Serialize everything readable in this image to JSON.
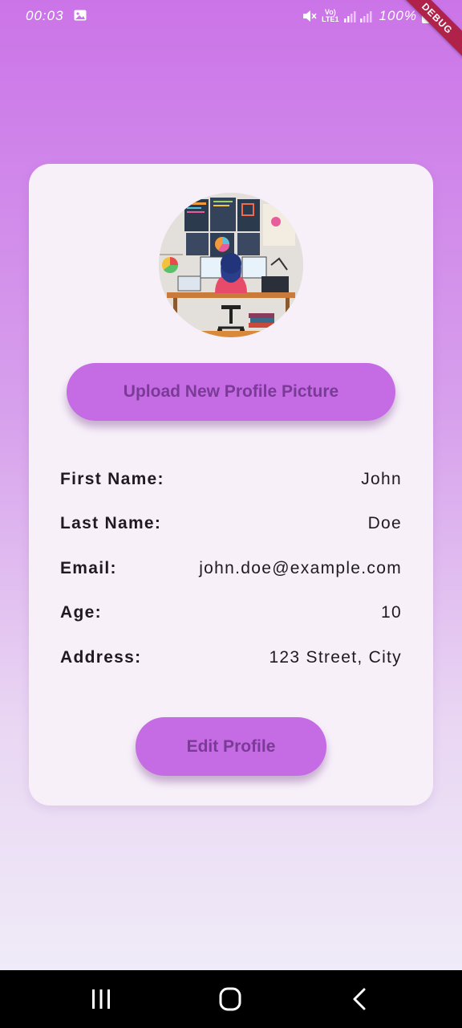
{
  "status_bar": {
    "time": "00:03",
    "lte_line1": "Vo)",
    "lte_line2": "LTE1",
    "battery": "100%"
  },
  "debug_banner": "DEBUG",
  "profile": {
    "upload_button_label": "Upload New Profile Picture",
    "fields": [
      {
        "label": "First Name:",
        "value": "John"
      },
      {
        "label": "Last Name:",
        "value": "Doe"
      },
      {
        "label": "Email:",
        "value": "john.doe@example.com"
      },
      {
        "label": "Age:",
        "value": "10"
      },
      {
        "label": "Address:",
        "value": "123 Street, City"
      }
    ],
    "edit_button_label": "Edit Profile"
  },
  "icons": {
    "status": [
      "image-icon",
      "mute-icon",
      "signal-icon",
      "battery-icon"
    ],
    "nav": [
      "recents-icon",
      "home-icon",
      "back-icon"
    ]
  },
  "colors": {
    "accent": "#c56be4",
    "button_text": "#7a3b96",
    "card": "#f7f0f9",
    "debug": "#b0224a"
  }
}
